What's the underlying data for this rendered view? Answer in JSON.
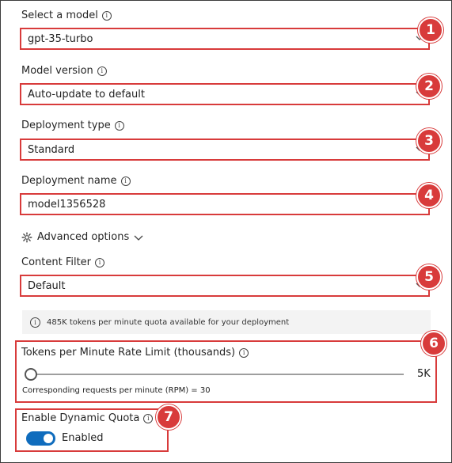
{
  "form": {
    "model": {
      "label": "Select a model",
      "value": "gpt-35-turbo",
      "step": "1"
    },
    "model_version": {
      "label": "Model version",
      "value": "Auto-update to default",
      "step": "2"
    },
    "deployment_type": {
      "label": "Deployment type",
      "value": "Standard",
      "step": "3"
    },
    "deployment_name": {
      "label": "Deployment name",
      "value": "model1356528",
      "step": "4"
    },
    "advanced_options": {
      "label": "Advanced options"
    },
    "content_filter": {
      "label": "Content Filter",
      "value": "Default",
      "step": "5"
    },
    "quota_info": "485K tokens per minute quota available for your deployment",
    "rate_limit": {
      "label": "Tokens per Minute Rate Limit (thousands)",
      "value_text": "5K",
      "level": 0,
      "rpm_text": "Corresponding requests per minute (RPM) = 30",
      "step": "6"
    },
    "dynamic_quota": {
      "label": "Enable Dynamic Quota",
      "state_text": "Enabled",
      "enabled": true,
      "step": "7"
    }
  },
  "colors": {
    "accent_red": "#d83b3b",
    "toggle_blue": "#0f6cbd"
  }
}
